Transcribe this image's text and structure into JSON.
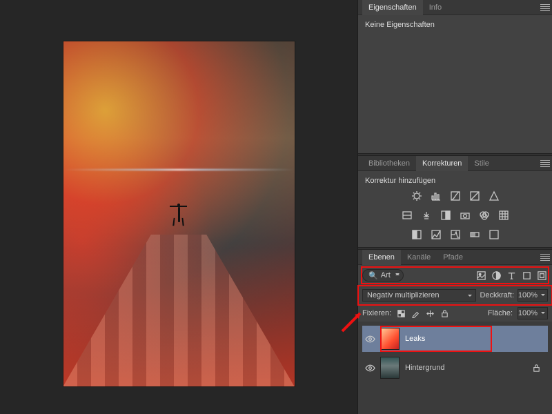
{
  "properties_panel": {
    "tabs": [
      "Eigenschaften",
      "Info"
    ],
    "active_tab": "Eigenschaften",
    "body_text": "Keine Eigenschaften"
  },
  "adjustments_panel": {
    "tabs": [
      "Bibliotheken",
      "Korrekturen",
      "Stile"
    ],
    "active_tab": "Korrekturen",
    "subtitle": "Korrektur hinzufügen"
  },
  "layers_panel": {
    "tabs": [
      "Ebenen",
      "Kanäle",
      "Pfade"
    ],
    "active_tab": "Ebenen",
    "filter_label": "Art",
    "blend_mode": "Negativ multiplizieren",
    "opacity_label": "Deckkraft:",
    "opacity_value": "100%",
    "lock_label": "Fixieren:",
    "fill_label": "Fläche:",
    "fill_value": "100%",
    "layers": [
      {
        "name": "Leaks",
        "visible": true,
        "selected": true,
        "locked": false
      },
      {
        "name": "Hintergrund",
        "visible": true,
        "selected": false,
        "locked": true
      }
    ]
  }
}
